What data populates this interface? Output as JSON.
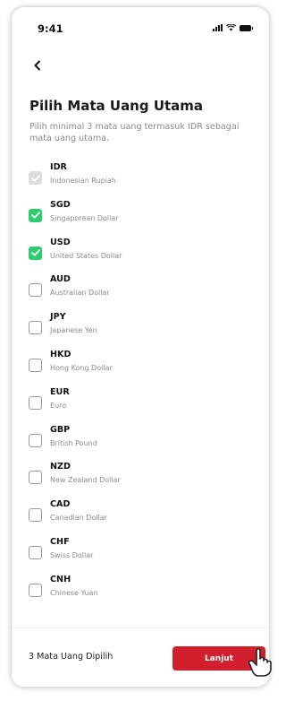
{
  "status_bar": {
    "time": "9:41"
  },
  "header": {
    "title": "Pilih Mata Uang Utama",
    "subtitle": "Pilih minimal 3 mata uang termasuk IDR sebagai mata uang utama."
  },
  "currencies": [
    {
      "code": "IDR",
      "name": "Indonesian Rupiah",
      "state": "disabled"
    },
    {
      "code": "SGD",
      "name": "Singaporean Dollar",
      "state": "checked"
    },
    {
      "code": "USD",
      "name": "United States Dollar",
      "state": "checked"
    },
    {
      "code": "AUD",
      "name": "Australian Dollar",
      "state": "unchecked"
    },
    {
      "code": "JPY",
      "name": "Japanese Yen",
      "state": "unchecked"
    },
    {
      "code": "HKD",
      "name": "Hong Kong Dollar",
      "state": "unchecked"
    },
    {
      "code": "EUR",
      "name": "Euro",
      "state": "unchecked"
    },
    {
      "code": "GBP",
      "name": "British Pound",
      "state": "unchecked"
    },
    {
      "code": "NZD",
      "name": "New Zealand Dollar",
      "state": "unchecked"
    },
    {
      "code": "CAD",
      "name": "Canadian Dollar",
      "state": "unchecked"
    },
    {
      "code": "CHF",
      "name": "Swiss Dollar",
      "state": "unchecked"
    },
    {
      "code": "CNH",
      "name": "Chinese Yuan",
      "state": "unchecked"
    }
  ],
  "footer": {
    "selected_label": "3 Mata Uang Dipilih",
    "next_label": "Lanjut"
  },
  "colors": {
    "accent": "#d11f2d",
    "check": "#2ecc71",
    "disabled": "#dcdcdc"
  }
}
